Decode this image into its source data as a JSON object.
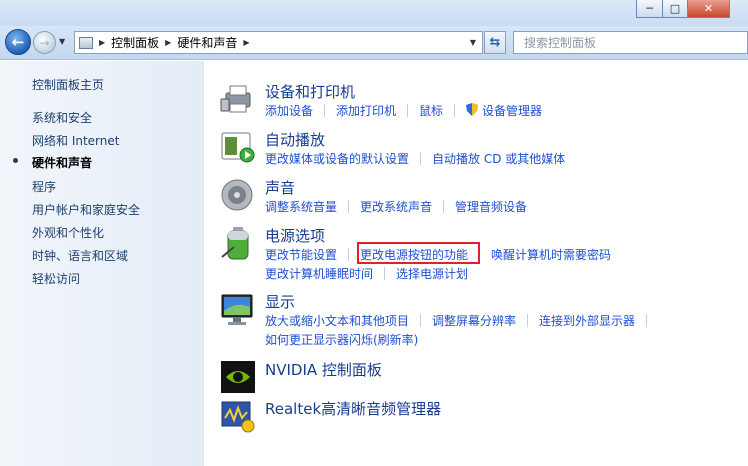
{
  "window": {
    "controls": {
      "minimize": "─",
      "maximize": "□",
      "close": "✕"
    }
  },
  "nav": {
    "back": "←",
    "forward": "→",
    "breadcrumb": [
      "控制面板",
      "硬件和声音"
    ],
    "search_placeholder": "搜索控制面板"
  },
  "sidebar": {
    "home": "控制面板主页",
    "items": [
      {
        "label": "系统和安全"
      },
      {
        "label": "网络和 Internet"
      },
      {
        "label": "硬件和声音",
        "active": true
      },
      {
        "label": "程序"
      },
      {
        "label": "用户帐户和家庭安全"
      },
      {
        "label": "外观和个性化"
      },
      {
        "label": "时钟、语言和区域"
      },
      {
        "label": "轻松访问"
      }
    ]
  },
  "categories": {
    "devices": {
      "title": "设备和打印机",
      "links": [
        "添加设备",
        "添加打印机",
        "鼠标",
        "设备管理器"
      ]
    },
    "autoplay": {
      "title": "自动播放",
      "links": [
        "更改媒体或设备的默认设置",
        "自动播放 CD 或其他媒体"
      ]
    },
    "sound": {
      "title": "声音",
      "links": [
        "调整系统音量",
        "更改系统声音",
        "管理音频设备"
      ]
    },
    "power": {
      "title": "电源选项",
      "links_row1": [
        "更改节能设置",
        "更改电源按钮的功能",
        "唤醒计算机时需要密码"
      ],
      "links_row2": [
        "更改计算机睡眠时间",
        "选择电源计划"
      ]
    },
    "display": {
      "title": "显示",
      "links_row1": [
        "放大或缩小文本和其他项目",
        "调整屏幕分辨率",
        "连接到外部显示器"
      ],
      "links_row2": [
        "如何更正显示器闪烁(刷新率)"
      ]
    },
    "nvidia": {
      "title": "NVIDIA 控制面板"
    },
    "realtek": {
      "title": "Realtek高清晰音频管理器"
    }
  },
  "colors": {
    "link": "#1f4fd1",
    "title": "#1a3d8e",
    "highlight": "#e0202a"
  }
}
